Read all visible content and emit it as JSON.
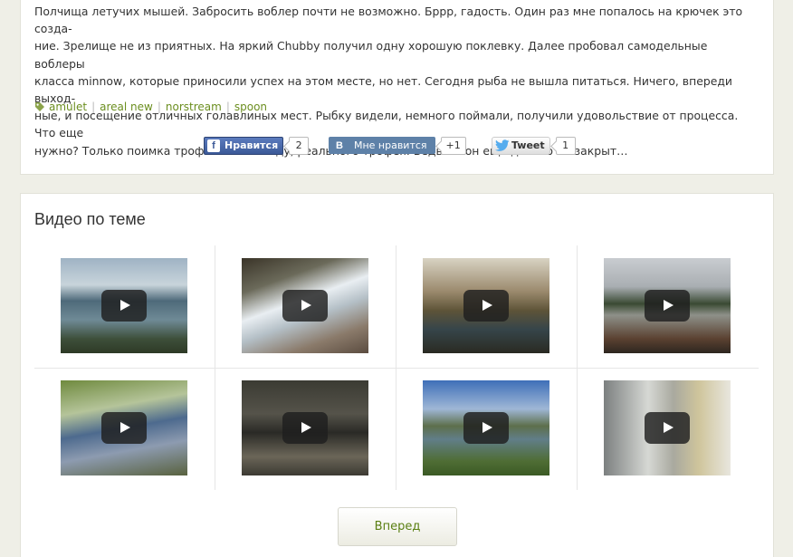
{
  "post": {
    "lines": [
      "Полчища летучих мышей. Забросить воблер почти не возможно. Бррр, гадость. Один раз мне попалось на крючек это созда-",
      "ние. Зрелище не из приятных. На яркий Chubby получил одну хорошую поклевку. Далее пробовал самодельные воблеры",
      "класса minnow, которые приносили успех на этом месте, но нет. Сегодня рыба не вышла питаться. Ничего, впереди выход-",
      "ные, и посещение отличных голавлиных мест. Рыбку видели, немного поймали, получили удовольствие от процесса. Что еще",
      "нужно? Только поимка трофея в этом году, реального трофея. Ведь сезон еще далеко не закрыт…"
    ],
    "tags": [
      "amulet",
      "areal new",
      "norstream",
      "spoon"
    ],
    "tag_separator": "|"
  },
  "share": {
    "facebook": {
      "logo": "f",
      "label": "Нравится",
      "count": "2"
    },
    "vk": {
      "logo": "В",
      "label": "Мне нравится",
      "count": "+1"
    },
    "twitter": {
      "label": "Tweet",
      "count": "1"
    }
  },
  "videos": {
    "title": "Видео по теме",
    "next_label": "Вперед",
    "items": [
      {
        "thumb": "lake-shore-thumbnail",
        "icon": "play-icon"
      },
      {
        "thumb": "snowy-creek-thumbnail",
        "icon": "play-icon"
      },
      {
        "thumb": "forest-river-thumbnail",
        "icon": "play-icon"
      },
      {
        "thumb": "angler-river-thumbnail",
        "icon": "play-icon"
      },
      {
        "thumb": "child-fishing-thumbnail",
        "icon": "play-icon"
      },
      {
        "thumb": "fishing-rod-closeup-thumbnail",
        "icon": "play-icon"
      },
      {
        "thumb": "man-at-river-thumbnail",
        "icon": "play-icon"
      },
      {
        "thumb": "indoor-room-thumbnail",
        "icon": "play-icon"
      }
    ]
  },
  "colors": {
    "page_bg": "#efefe7",
    "tag_green": "#6b8e1f",
    "facebook_blue": "#3b5998",
    "vk_blue": "#5e81a8",
    "next_text": "#5a7f12"
  }
}
